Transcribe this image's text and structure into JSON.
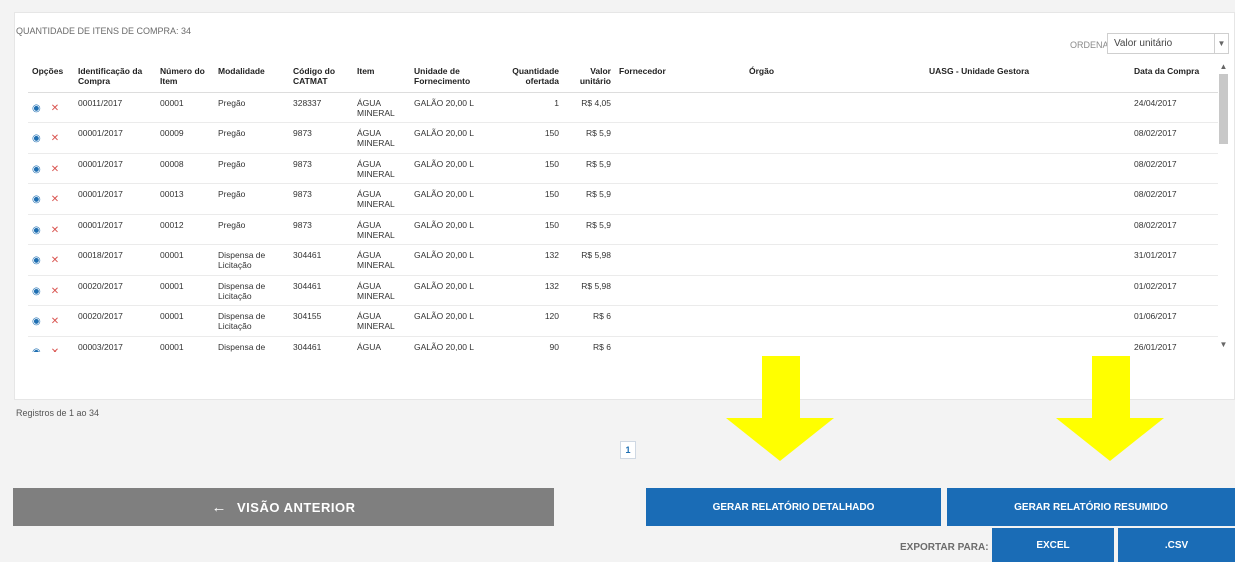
{
  "header": {
    "qty_label": "QUANTIDADE DE ITENS DE COMPRA: 34",
    "order_label": "ORDENAR:",
    "order_value": "Valor unitário"
  },
  "table": {
    "columns": [
      "Opções",
      "Identificação da Compra",
      "Número do Item",
      "Modalidade",
      "Código do CATMAT",
      "Item",
      "Unidade de Fornecimento",
      "Quantidade ofertada",
      "Valor unitário",
      "Fornecedor",
      "Órgão",
      "UASG - Unidade Gestora",
      "Data da Compra"
    ],
    "rows": [
      {
        "id": "00011/2017",
        "item_no": "00001",
        "mod": "Pregão",
        "catmat": "328337",
        "item": "ÁGUA MINERAL",
        "unid": "GALÃO 20,00 L",
        "qtd": "1",
        "valor": "R$ 4,05",
        "data": "24/04/2017"
      },
      {
        "id": "00001/2017",
        "item_no": "00009",
        "mod": "Pregão",
        "catmat": "9873",
        "item": "ÁGUA MINERAL",
        "unid": "GALÃO 20,00 L",
        "qtd": "150",
        "valor": "R$ 5,9",
        "data": "08/02/2017"
      },
      {
        "id": "00001/2017",
        "item_no": "00008",
        "mod": "Pregão",
        "catmat": "9873",
        "item": "ÁGUA MINERAL",
        "unid": "GALÃO 20,00 L",
        "qtd": "150",
        "valor": "R$ 5,9",
        "data": "08/02/2017"
      },
      {
        "id": "00001/2017",
        "item_no": "00013",
        "mod": "Pregão",
        "catmat": "9873",
        "item": "ÁGUA MINERAL",
        "unid": "GALÃO 20,00 L",
        "qtd": "150",
        "valor": "R$ 5,9",
        "data": "08/02/2017"
      },
      {
        "id": "00001/2017",
        "item_no": "00012",
        "mod": "Pregão",
        "catmat": "9873",
        "item": "ÁGUA MINERAL",
        "unid": "GALÃO 20,00 L",
        "qtd": "150",
        "valor": "R$ 5,9",
        "data": "08/02/2017"
      },
      {
        "id": "00018/2017",
        "item_no": "00001",
        "mod": "Dispensa de Licitação",
        "catmat": "304461",
        "item": "ÁGUA MINERAL",
        "unid": "GALÃO 20,00 L",
        "qtd": "132",
        "valor": "R$ 5,98",
        "data": "31/01/2017"
      },
      {
        "id": "00020/2017",
        "item_no": "00001",
        "mod": "Dispensa de Licitação",
        "catmat": "304461",
        "item": "ÁGUA MINERAL",
        "unid": "GALÃO 20,00 L",
        "qtd": "132",
        "valor": "R$ 5,98",
        "data": "01/02/2017"
      },
      {
        "id": "00020/2017",
        "item_no": "00001",
        "mod": "Dispensa de Licitação",
        "catmat": "304155",
        "item": "ÁGUA MINERAL",
        "unid": "GALÃO 20,00 L",
        "qtd": "120",
        "valor": "R$ 6",
        "data": "01/06/2017"
      },
      {
        "id": "00003/2017",
        "item_no": "00001",
        "mod": "Dispensa de",
        "catmat": "304461",
        "item": "ÁGUA",
        "unid": "GALÃO 20,00 L",
        "qtd": "90",
        "valor": "R$ 6",
        "data": "26/01/2017"
      }
    ]
  },
  "footer": {
    "records": "Registros de 1 ao 34",
    "page": "1",
    "back_label": "VISÃO ANTERIOR",
    "detailed_label": "GERAR RELATÓRIO DETALHADO",
    "summary_label": "GERAR RELATÓRIO RESUMIDO",
    "export_label": "EXPORTAR PARA:",
    "excel_label": "EXCEL",
    "csv_label": ".CSV"
  },
  "icons": {
    "view": "eye-icon",
    "remove": "close-icon",
    "back": "arrow-left-icon"
  },
  "colors": {
    "accent_blue": "#1a6cb6",
    "back_gray": "#7f7f7f",
    "highlight_arrow": "#ffff00",
    "remove_red": "#d9534f"
  }
}
